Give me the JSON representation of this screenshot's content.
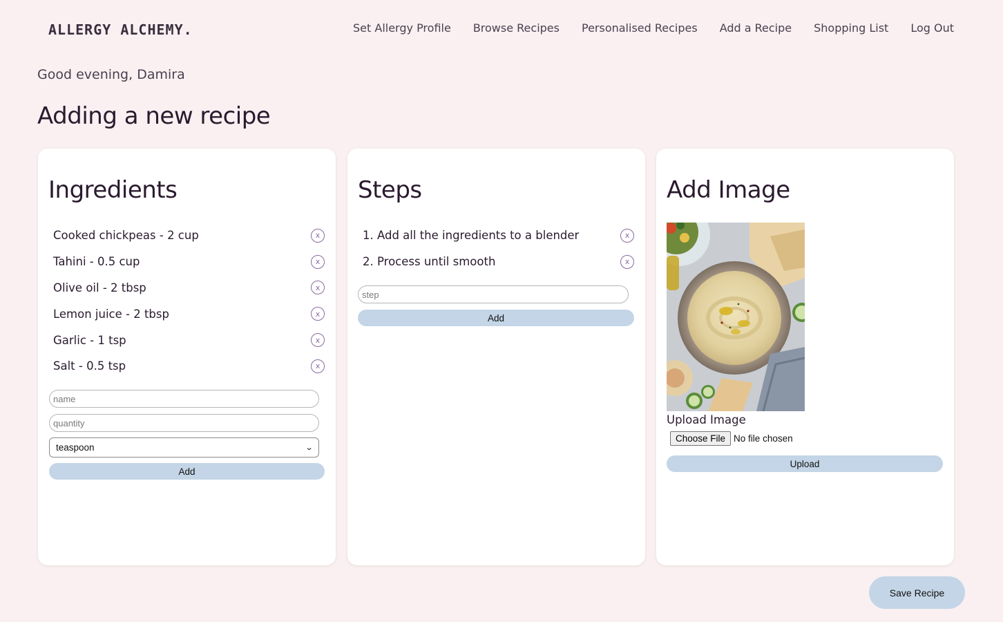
{
  "header": {
    "logo": "ALLERGY ALCHEMY.",
    "nav": [
      {
        "label": "Set Allergy Profile"
      },
      {
        "label": "Browse Recipes"
      },
      {
        "label": "Personalised Recipes"
      },
      {
        "label": "Add a Recipe"
      },
      {
        "label": "Shopping List"
      },
      {
        "label": "Log Out"
      }
    ]
  },
  "greeting": "Good evening, Damira",
  "page_title": "Adding a new recipe",
  "ingredients": {
    "title": "Ingredients",
    "items": [
      {
        "text": "Cooked chickpeas - 2 cup"
      },
      {
        "text": "Tahini - 0.5 cup"
      },
      {
        "text": "Olive oil - 2 tbsp"
      },
      {
        "text": "Lemon juice - 2 tbsp"
      },
      {
        "text": "Garlic - 1 tsp"
      },
      {
        "text": "Salt - 0.5 tsp"
      }
    ],
    "remove_label": "x",
    "name_placeholder": "name",
    "quantity_placeholder": "quantity",
    "unit_selected": "teaspoon",
    "add_label": "Add"
  },
  "steps": {
    "title": "Steps",
    "items": [
      {
        "text": "1. Add all the ingredients to a blender"
      },
      {
        "text": "2. Process until smooth"
      }
    ],
    "remove_label": "x",
    "step_placeholder": "step",
    "add_label": "Add"
  },
  "image": {
    "title": "Add Image",
    "upload_label": "Upload Image",
    "choose_file_label": "Choose File",
    "no_file_text": "No file chosen",
    "upload_button": "Upload"
  },
  "save_label": "Save Recipe",
  "colors": {
    "background": "#faf0f1",
    "card": "#ffffff",
    "button": "#c3d5e6",
    "remove_icon": "#8a6aa0",
    "heading": "#2a1a2e"
  }
}
